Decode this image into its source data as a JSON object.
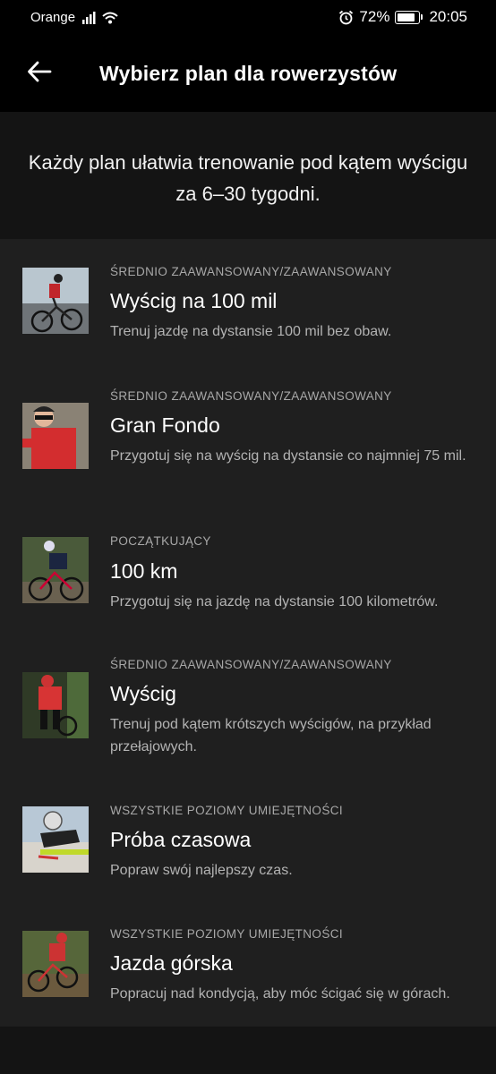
{
  "status": {
    "carrier": "Orange",
    "battery": "72%",
    "time": "20:05"
  },
  "header": {
    "title": "Wybierz plan dla rowerzystów"
  },
  "intro": {
    "text": "Każdy plan ułatwia trenowanie pod kątem wyścigu za 6–30 tygodni."
  },
  "plans": [
    {
      "level": "ŚREDNIO ZAAWANSOWANY/ZAAWANSOWANY",
      "name": "Wyścig na 100 mil",
      "desc": "Trenuj jazdę na dystansie 100 mil bez obaw."
    },
    {
      "level": "ŚREDNIO ZAAWANSOWANY/ZAAWANSOWANY",
      "name": "Gran Fondo",
      "desc": "Przygotuj się na wyścig na dystansie co najmniej 75 mil."
    },
    {
      "level": "POCZĄTKUJĄCY",
      "name": "100 km",
      "desc": "Przygotuj się na jazdę na dystansie 100 kilometrów."
    },
    {
      "level": "ŚREDNIO ZAAWANSOWANY/ZAAWANSOWANY",
      "name": "Wyścig",
      "desc": "Trenuj pod kątem krótszych wyścigów, na przykład przełajowych."
    },
    {
      "level": "WSZYSTKIE POZIOMY UMIEJĘTNOŚCI",
      "name": "Próba czasowa",
      "desc": "Popraw swój najlepszy czas."
    },
    {
      "level": "WSZYSTKIE POZIOMY UMIEJĘTNOŚCI",
      "name": "Jazda górska",
      "desc": "Popracuj nad kondycją, aby móc ścigać się w górach."
    }
  ]
}
